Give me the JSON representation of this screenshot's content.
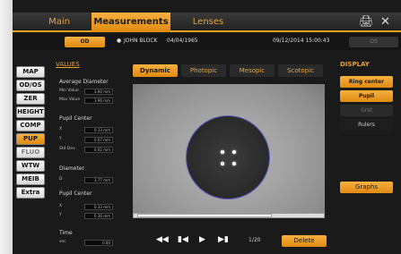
{
  "tabs": [
    {
      "label": "Main",
      "active": false
    },
    {
      "label": "Measurements",
      "active": true
    },
    {
      "label": "Lenses",
      "active": false
    }
  ],
  "toolbar": {
    "print_icon": "printer-icon",
    "tools_icon": "tools-icon"
  },
  "header": {
    "eye_od": "OD",
    "patient_name": "JOHN BLOCK",
    "patient_dob": "04/04/1965",
    "exam_datetime": "09/12/2014 15:00:43",
    "eye_os": "OS"
  },
  "side_menu": [
    {
      "label": "MAP"
    },
    {
      "label": "OD/OS"
    },
    {
      "label": "ZER"
    },
    {
      "label": "HEIGHT"
    },
    {
      "label": "COMP"
    },
    {
      "label": "PUP",
      "active": true
    },
    {
      "label": "FLUO"
    },
    {
      "label": "WTW"
    },
    {
      "label": "MEIB"
    },
    {
      "label": "Extra"
    }
  ],
  "values": {
    "title": "VALUES",
    "avg_diameter": {
      "label": "Average Diameter",
      "min_label": "Min Value",
      "min_value": "3.60 mm",
      "max_label": "Max Value",
      "max_value": "3.96 mm"
    },
    "pupil_center1": {
      "label": "Pupil Center",
      "x_label": "X",
      "x_value": "0.33 mm",
      "y_label": "Y",
      "y_value": "0.07 mm",
      "std_label": "Std Dev",
      "std_value": "0.02 mm"
    },
    "diameter": {
      "label": "Diameter",
      "d_label": "D",
      "d_value": "3.77 mm"
    },
    "pupil_center2": {
      "label": "Pupil Center",
      "x_label": "X",
      "x_value": "0.33 mm",
      "y_label": "Y",
      "y_value": "0.36 mm"
    },
    "time": {
      "label": "Time",
      "sec_label": "sec",
      "sec_value": "0.00"
    }
  },
  "modes": [
    {
      "label": "Dynamic",
      "active": true
    },
    {
      "label": "Photopic",
      "active": false
    },
    {
      "label": "Mesopic",
      "active": false
    },
    {
      "label": "Scotopic",
      "active": false
    }
  ],
  "playback": {
    "frame_counter": "1/20",
    "delete_label": "Delete"
  },
  "display": {
    "title": "DISPLAY",
    "buttons": [
      {
        "label": "Ring center",
        "state": "on"
      },
      {
        "label": "Pupil",
        "state": "on"
      },
      {
        "label": "Grid",
        "state": "dim"
      },
      {
        "label": "Rulers",
        "state": "off"
      }
    ],
    "graphs_label": "Graphs"
  },
  "colors": {
    "accent": "#f0a020",
    "background": "#1a1a1a"
  }
}
